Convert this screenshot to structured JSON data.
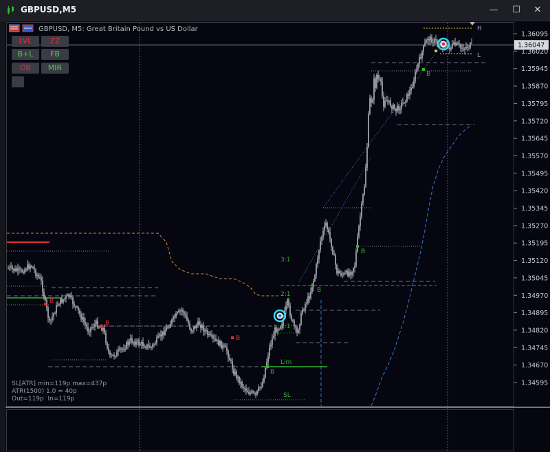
{
  "window": {
    "title": "GBPUSD,M5",
    "minimize_glyph": "—",
    "maximize_glyph": "☐",
    "close_glyph": "✕"
  },
  "chart_header": {
    "symbol_text": "GBPUSD, M5:  Great Britain Pound vs US Dollar"
  },
  "toolbar_buttons": {
    "lvl": "LVL",
    "zz": "ZZ",
    "bl": "B+L",
    "fb": "FB",
    "ob": "OB",
    "mir": "MIR"
  },
  "info_lines": {
    "line1": "SL[ATR] min=119p max=437p",
    "line2": "ATR(1500) 1.0 = 40p",
    "line3": "Out=119p  In=119p"
  },
  "price_axis": {
    "labels": [
      "1.36095",
      "1.36020",
      "1.35945",
      "1.35870",
      "1.35795",
      "1.35720",
      "1.35645",
      "1.35570",
      "1.35495",
      "1.35420",
      "1.35345",
      "1.35270",
      "1.35195",
      "1.35120",
      "1.35045",
      "1.34970",
      "1.34895",
      "1.34820",
      "1.34745",
      "1.34670",
      "1.34595"
    ],
    "current_price": "1.36047"
  },
  "annotations": {
    "h": "H",
    "l": "L",
    "ratio31": "3:1",
    "ratio21": "2:1",
    "ratio11": "1:1",
    "lim": "Lim",
    "sl": "SL",
    "b": "B"
  },
  "colors": {
    "candle": "#b4b6bc",
    "bg": "#05060f",
    "grid": "#5a5c66",
    "orange": "#d98a40",
    "blue_dash": "#3a78d0",
    "green": "#2fb52f",
    "red": "#e0303a",
    "yellow": "#e8d020",
    "cyan": "#3ad4f0"
  }
}
